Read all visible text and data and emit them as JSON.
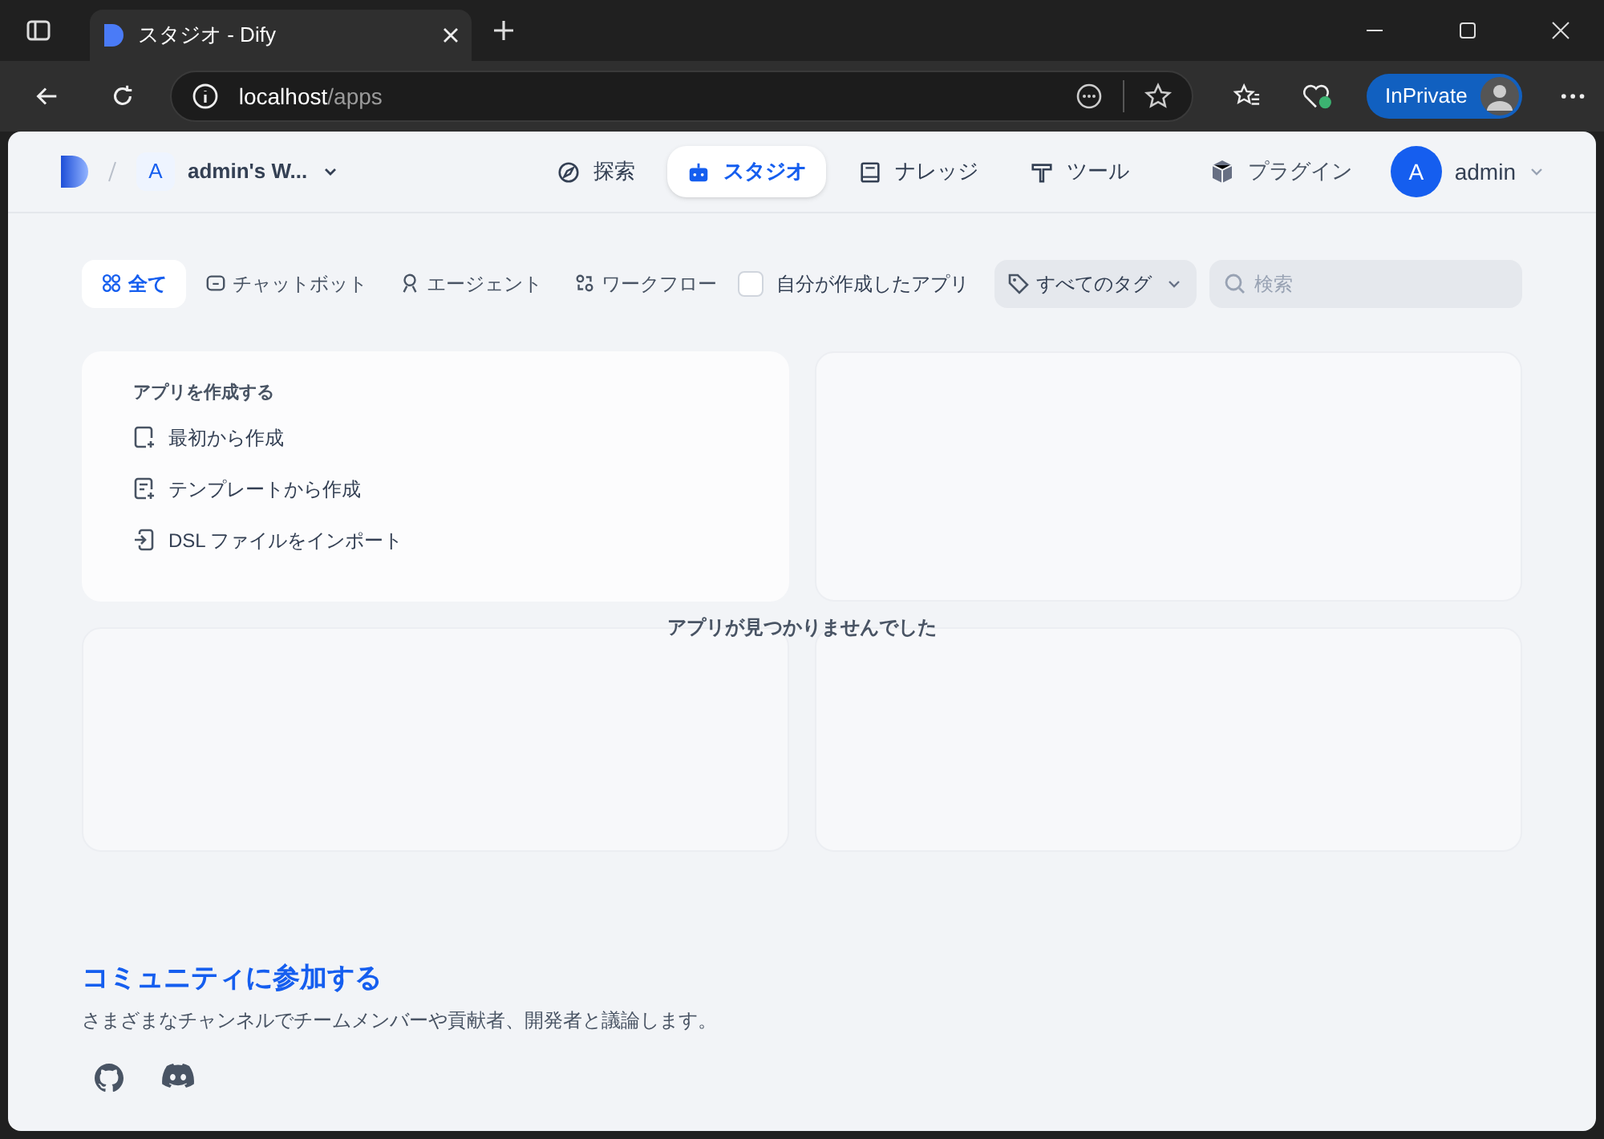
{
  "browser": {
    "tab_title": "スタジオ - Dify",
    "url_host": "localhost",
    "url_path": "/apps",
    "profile_label": "InPrivate"
  },
  "header": {
    "workspace_initial": "A",
    "workspace_name": "admin's W...",
    "nav": [
      {
        "label": "探索",
        "selected": false
      },
      {
        "label": "スタジオ",
        "selected": true
      },
      {
        "label": "ナレッジ",
        "selected": false
      },
      {
        "label": "ツール",
        "selected": false
      }
    ],
    "plugin_label": "プラグイン",
    "user_initial": "A",
    "user_name": "admin"
  },
  "filters": {
    "tabs": [
      {
        "label": "全て",
        "selected": true
      },
      {
        "label": "チャットボット",
        "selected": false
      },
      {
        "label": "エージェント",
        "selected": false
      },
      {
        "label": "ワークフロー",
        "selected": false
      }
    ],
    "mine": {
      "label": "自分が作成したアプリ",
      "checked": false
    },
    "tags_label": "すべてのタグ",
    "search_placeholder": "検索"
  },
  "create_card": {
    "title": "アプリを作成する",
    "items": [
      {
        "label": "最初から作成"
      },
      {
        "label": "テンプレートから作成"
      },
      {
        "label": "DSL ファイルをインポート"
      }
    ]
  },
  "empty_message": "アプリが見つかりませんでした",
  "community": {
    "title": "コミュニティに参加する",
    "description": "さまざまなチャンネルでチームメンバーや貢献者、開発者と議論します。"
  }
}
